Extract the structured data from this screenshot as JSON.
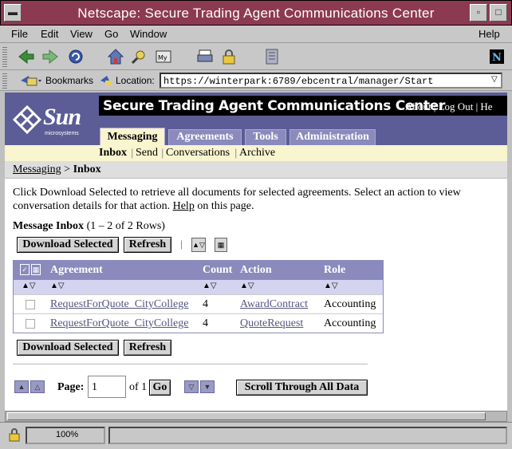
{
  "window": {
    "title": "Netscape: Secure Trading Agent Communications Center"
  },
  "menu": [
    "File",
    "Edit",
    "View",
    "Go",
    "Window",
    "Help"
  ],
  "locationbar": {
    "bookmarks_label": "Bookmarks",
    "location_label": "Location:",
    "url": "https://winterpark:6789/ebcentral/manager/Start"
  },
  "header": {
    "logo_text": "Sun",
    "logo_sub": "microsystems",
    "title": "Secure Trading Agent Communications Center",
    "links": [
      "About",
      "Log Out",
      "He"
    ]
  },
  "tabs": [
    "Messaging",
    "Agreements",
    "Tools",
    "Administration"
  ],
  "subnav": [
    "Inbox",
    "Send",
    "Conversations",
    "Archive"
  ],
  "breadcrumb": {
    "parent": "Messaging",
    "separator": ">",
    "current": "Inbox"
  },
  "content": {
    "instructions_before": "Click Download Selected to retrieve all documents for selected agreements. Select an action to view conversation details for that action.",
    "help_link": "Help",
    "instructions_after": "on this page.",
    "inbox_title": "Message Inbox",
    "inbox_count": "(1 – 2 of 2 Rows)",
    "download_label": "Download Selected",
    "refresh_label": "Refresh"
  },
  "table": {
    "headers": [
      "Agreement",
      "Count",
      "Action",
      "Role"
    ],
    "rows": [
      {
        "agreement": "RequestForQuote_CityCollege",
        "count": "4",
        "action": "AwardContract",
        "role": "Accounting"
      },
      {
        "agreement": "RequestForQuote_CityCollege",
        "count": "4",
        "action": "QuoteRequest",
        "role": "Accounting"
      }
    ]
  },
  "pagination": {
    "page_label": "Page:",
    "page_value": "1",
    "of_label": "of 1",
    "go_label": "Go",
    "scroll_all_label": "Scroll Through All Data"
  },
  "status": {
    "zoom": "100%"
  },
  "colors": {
    "titlebar": "#8c3a52",
    "masthead": "#5c5c96",
    "tab_inactive": "#8a8abd",
    "tab_active": "#f8f5cf",
    "link": "#55557f"
  }
}
